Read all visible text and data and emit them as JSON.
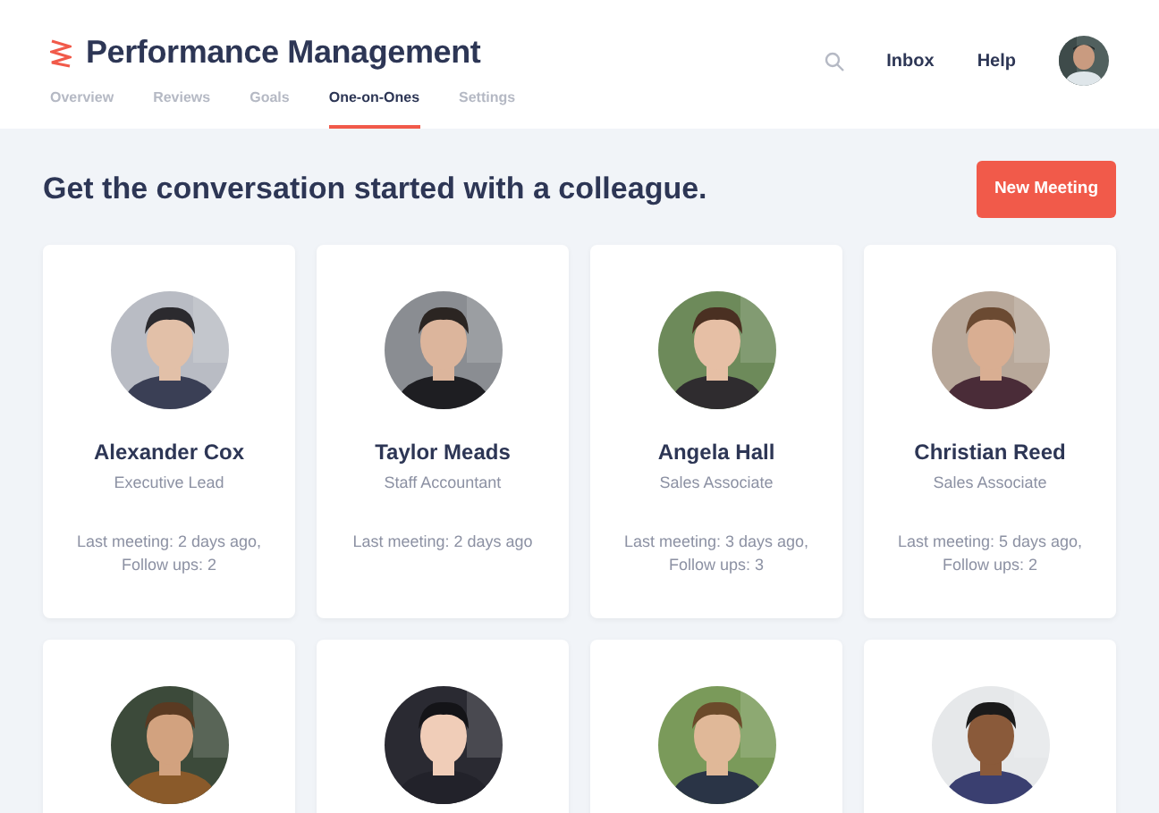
{
  "app": {
    "title": "Performance Management"
  },
  "tabs": [
    {
      "label": "Overview",
      "selected": false
    },
    {
      "label": "Reviews",
      "selected": false
    },
    {
      "label": "Goals",
      "selected": false
    },
    {
      "label": "One-on-Ones",
      "selected": true
    },
    {
      "label": "Settings",
      "selected": false
    }
  ],
  "header_links": [
    "Inbox",
    "Help"
  ],
  "heading": "Get the conversation started with a colleague.",
  "new_button": "New Meeting",
  "people": [
    {
      "kind": "full",
      "name": "Alexander Cox",
      "role": "Executive Lead",
      "meeting": "Last meeting: 2 days ago, Follow ups: 2"
    },
    {
      "kind": "full",
      "name": "Taylor Meads",
      "role": "Staff Accountant",
      "meeting": "Last meeting: 2 days ago"
    },
    {
      "kind": "full",
      "name": "Angela Hall",
      "role": "Sales Associate",
      "meeting": "Last meeting: 3 days ago, Follow ups: 3"
    },
    {
      "kind": "full",
      "name": "Christian Reed",
      "role": "Sales Associate",
      "meeting": "Last meeting: 5 days ago, Follow ups: 2"
    },
    {
      "kind": "picture"
    },
    {
      "kind": "picture"
    },
    {
      "kind": "picture"
    },
    {
      "kind": "picture"
    }
  ]
}
